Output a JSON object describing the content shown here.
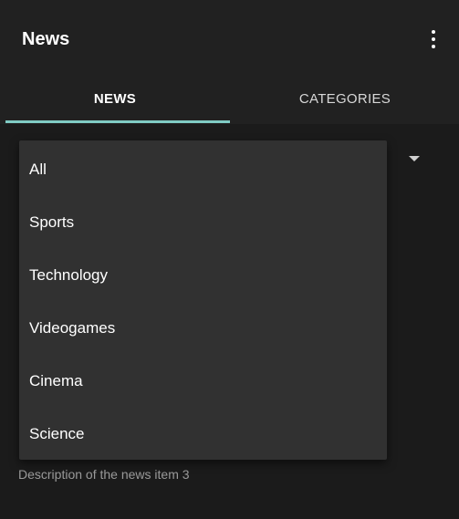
{
  "appbar": {
    "title": "News",
    "menu_icon": "more-vert-icon"
  },
  "tabs": [
    {
      "label": "NEWS",
      "selected": true
    },
    {
      "label": "CATEGORIES",
      "selected": false
    }
  ],
  "colors": {
    "appbar_bg": "#212121",
    "page_bg": "#1b1b1b",
    "dropdown_bg": "#313131",
    "tab_indicator": "#80cbc4"
  },
  "spinner": {
    "arrow_icon": "arrow-drop-down-icon",
    "options": [
      "All",
      "Sports",
      "Technology",
      "Videogames",
      "Cinema",
      "Science"
    ]
  },
  "news_item": {
    "description": "Description of the news item 3"
  }
}
